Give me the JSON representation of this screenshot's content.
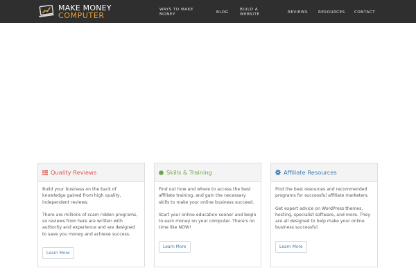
{
  "header": {
    "logo": {
      "line1": "MAKE MONEY",
      "line2": "COMPUTER",
      "icon": "laptop-chart-icon"
    },
    "nav": [
      {
        "label": "WAYS TO MAKE MONEY"
      },
      {
        "label": "BLOG"
      },
      {
        "label": "BUILD A WEBSITE"
      },
      {
        "label": "REVIEWS"
      },
      {
        "label": "RESOURCES"
      },
      {
        "label": "CONTACT"
      }
    ]
  },
  "cards": [
    {
      "icon": "list-icon",
      "title": "Quality Reviews",
      "paragraphs": [
        "Build your business on the back of knowledge gained from high quality, independent reviews.",
        "There are millions of scam ridden programs, so reviews from here are written with authority and experience and are designed to save you money and achieve success."
      ],
      "button": "Learn More"
    },
    {
      "icon": "circle-icon",
      "title": "Skills & Training",
      "paragraphs": [
        "Find out how and where to access the best affiliate training, and gain the necessary skills to make your online business succeed.",
        "Start your online education sooner and begin to earn money on your computer. There's no time like NOW!"
      ],
      "button": "Learn More"
    },
    {
      "icon": "gear-icon",
      "title": "Affiliate Resources",
      "paragraphs": [
        "Find the best resources and recommended programs for successful affiliate marketers.",
        "Get expert advice on WordPress themes, hosting, specialist software, and more. They are all designed to help make your online business successful."
      ],
      "button": "Learn More"
    }
  ],
  "colors": {
    "header_bg": "#2f2f2f",
    "accent_orange": "#f1a12b",
    "red": "#d9534f",
    "green": "#6da34d",
    "blue": "#3a7ab4"
  }
}
